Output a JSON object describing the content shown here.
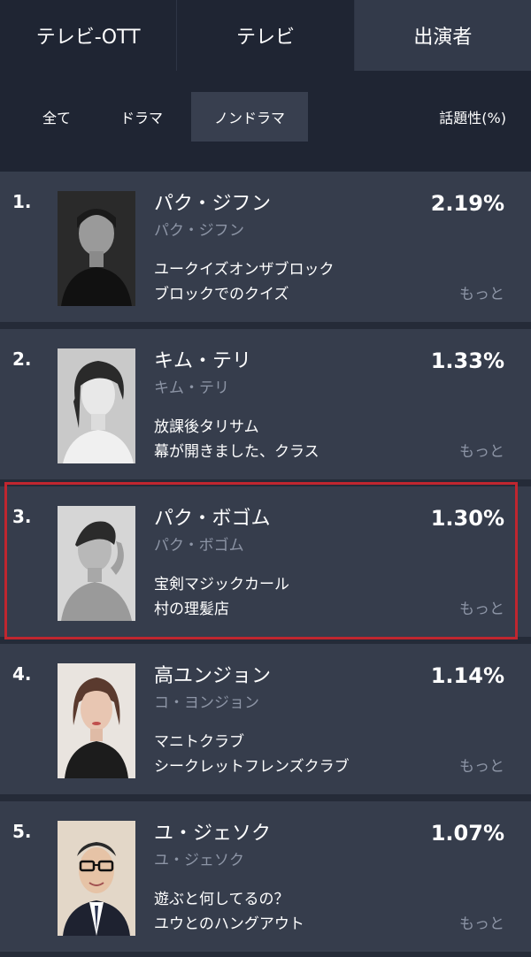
{
  "tabs": [
    {
      "label": "テレビ-OTT",
      "active": false
    },
    {
      "label": "テレビ",
      "active": false
    },
    {
      "label": "出演者",
      "active": true
    }
  ],
  "filters": [
    {
      "label": "全て",
      "active": false
    },
    {
      "label": "ドラマ",
      "active": false
    },
    {
      "label": "ノンドラマ",
      "active": true
    }
  ],
  "metric_label": "話題性(%)",
  "rankings": [
    {
      "rank": "1.",
      "name": "パク・ジフン",
      "subname": "パク・ジフン",
      "shows": [
        "ユークイズオンザブロック",
        "ブロックでのクイズ"
      ],
      "percent": "2.19%",
      "more": "もっと"
    },
    {
      "rank": "2.",
      "name": "キム・テリ",
      "subname": "キム・テリ",
      "shows": [
        "放課後タリサム",
        "幕が開きました、クラス"
      ],
      "percent": "1.33%",
      "more": "もっと"
    },
    {
      "rank": "3.",
      "name": "パク・ボゴム",
      "subname": "パク・ボゴム",
      "shows": [
        "宝剣マジックカール",
        "村の理髪店"
      ],
      "percent": "1.30%",
      "more": "もっと"
    },
    {
      "rank": "4.",
      "name": "高ユンジョン",
      "subname": "コ・ヨンジョン",
      "shows": [
        "マニトクラブ",
        "シークレットフレンズクラブ"
      ],
      "percent": "1.14%",
      "more": "もっと"
    },
    {
      "rank": "5.",
      "name": "ユ・ジェソク",
      "subname": "ユ・ジェソク",
      "shows": [
        "遊ぶと何してるの？",
        "ユウとのハングアウト"
      ],
      "percent": "1.07%",
      "more": "もっと"
    }
  ],
  "colors": {
    "background": "#252b38",
    "header": "#1f2533",
    "row": "#363d4c",
    "active_tab": "#333a4a",
    "highlight": "#c0262f",
    "muted_text": "#8d95a6"
  }
}
